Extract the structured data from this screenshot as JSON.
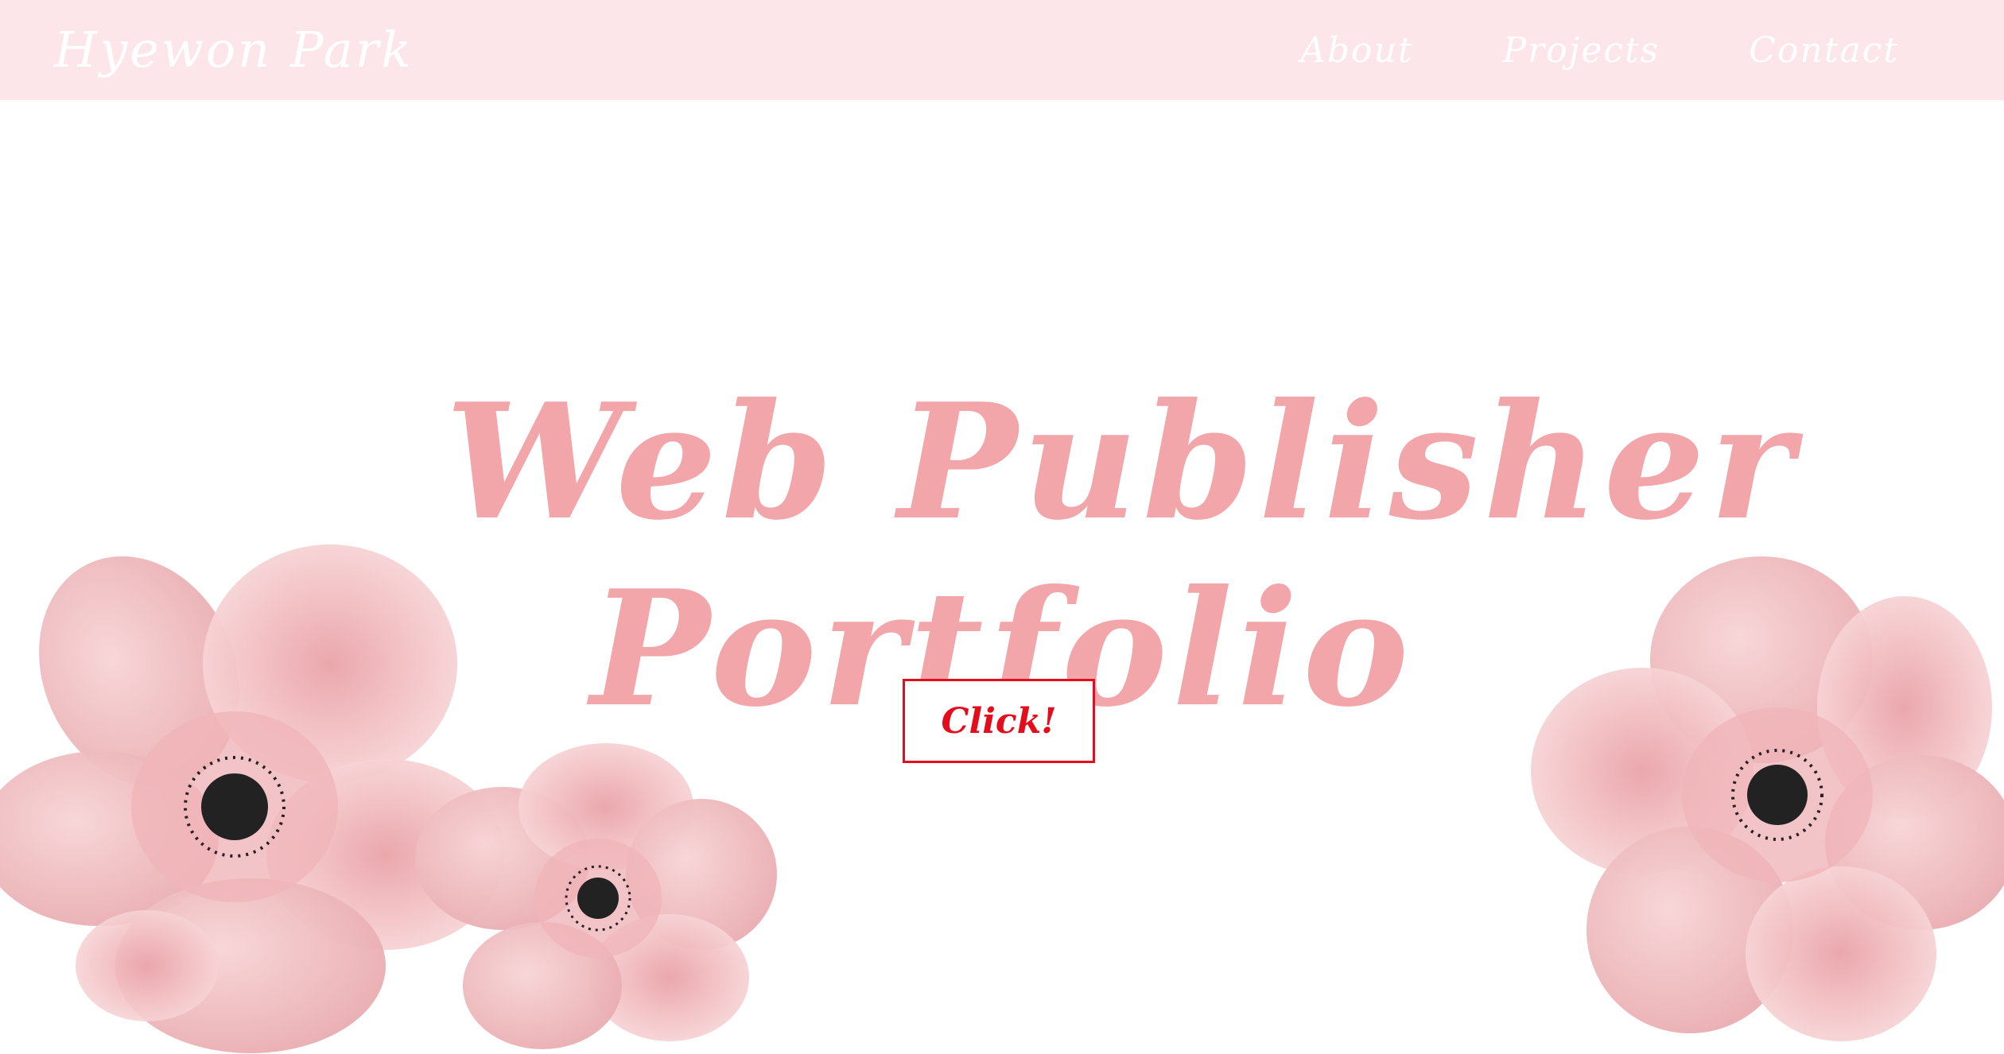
{
  "nav": {
    "brand": "Hyewon Park",
    "links": [
      "About",
      "Projects",
      "Contact"
    ]
  },
  "hero": {
    "title_line1": "Web Publisher",
    "title_line2": "Portfolio",
    "button_label": "Click!"
  },
  "colors": {
    "nav_background": "#fde6ea",
    "title_pink": "#f2a6aa",
    "button_red": "#e30d1c",
    "petal_pink": "#f3c3c6",
    "flower_center": "#222222"
  },
  "icons": {
    "flowers": [
      "flower-large-left-icon",
      "flower-small-left-icon",
      "flower-right-icon"
    ]
  }
}
